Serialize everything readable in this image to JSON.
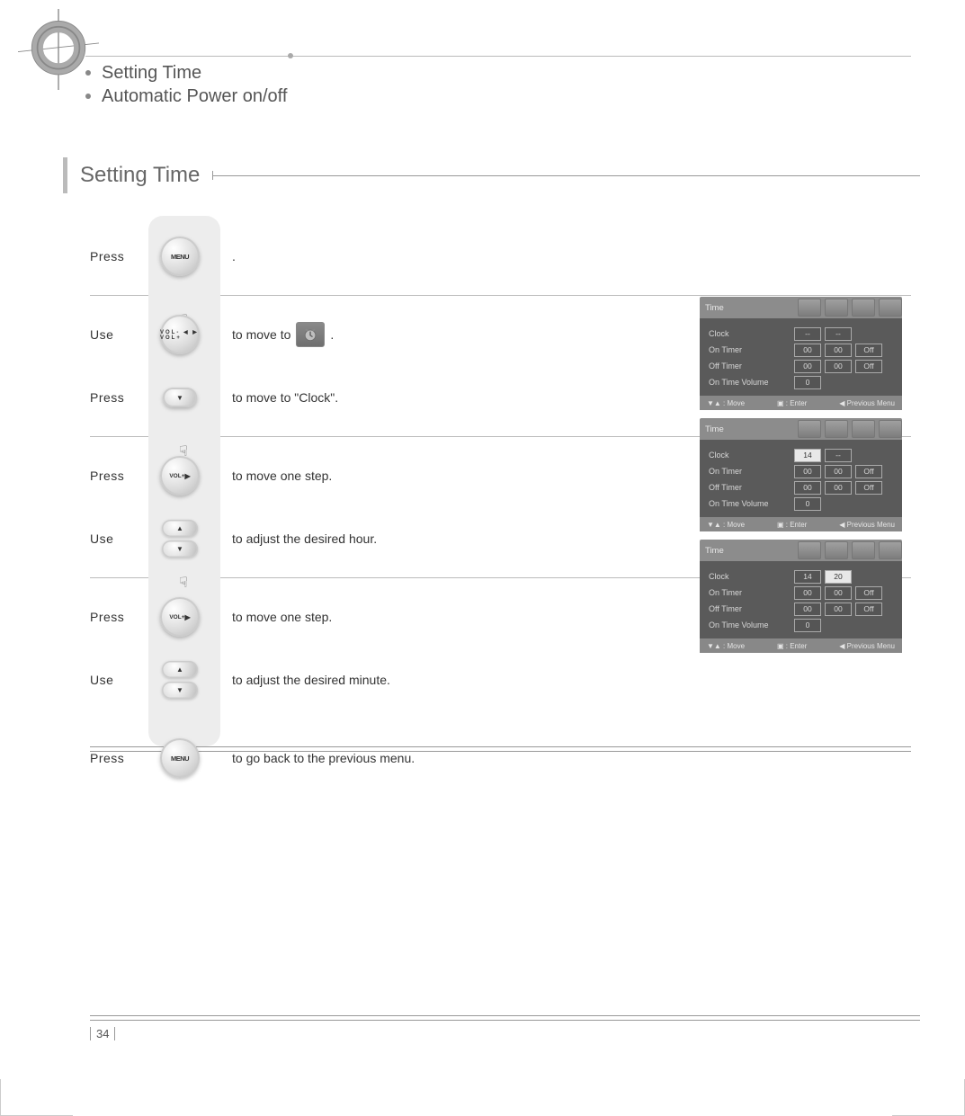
{
  "toc": {
    "item1": "Setting Time",
    "item2": "Automatic Power on/off"
  },
  "section_title": "Setting Time",
  "steps": [
    {
      "action": "Press",
      "button": "MENU",
      "after_pre": "",
      "after_post": "."
    },
    {
      "action": "Use",
      "button": "VOLLR",
      "after_pre": "to move to",
      "after_post": "."
    },
    {
      "action": "Press",
      "button": "DOWN",
      "after_pre": "to move to \"Clock\".",
      "after_post": ""
    },
    {
      "action": "Press",
      "button": "VOLR",
      "after_pre": "to move one step.",
      "after_post": ""
    },
    {
      "action": "Use",
      "button": "UPDOWN",
      "after_pre": "to adjust the desired hour.",
      "after_post": ""
    },
    {
      "action": "Press",
      "button": "VOLR",
      "after_pre": "to move one step.",
      "after_post": ""
    },
    {
      "action": "Use",
      "button": "UPDOWN",
      "after_pre": "to adjust the desired minute.",
      "after_post": ""
    },
    {
      "action": "Press",
      "button": "MENU",
      "after_pre": "to go back to the previous menu.",
      "after_post": ""
    }
  ],
  "osd": {
    "title": "Time",
    "rows": {
      "clock": "Clock",
      "on_timer": "On Timer",
      "off_timer": "Off Timer",
      "on_time_volume": "On Time Volume"
    },
    "values": {
      "dash": "--",
      "h14": "14",
      "m00": "00",
      "m20": "20",
      "zero": "0",
      "off": "Off"
    },
    "footer": {
      "move": "▼▲ : Move",
      "enter": "▣ : Enter",
      "prev": "◀ Previous Menu"
    }
  },
  "page_number": "34"
}
